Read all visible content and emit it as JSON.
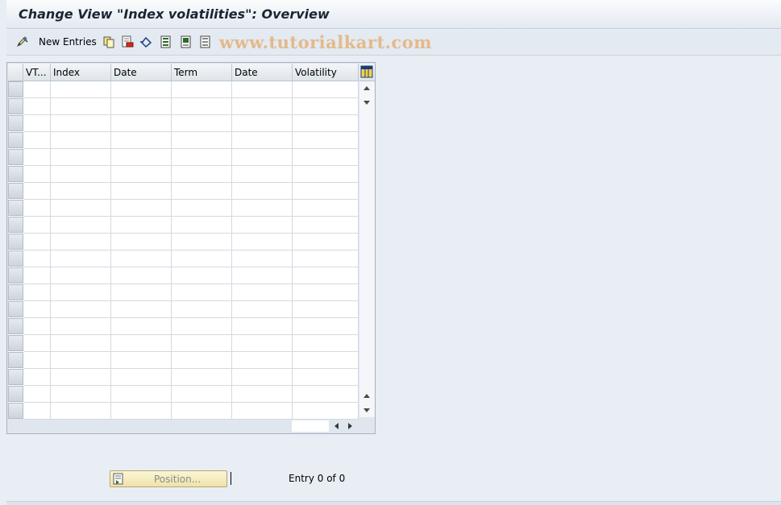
{
  "window": {
    "title": "Change View \"Index volatilities\": Overview"
  },
  "toolbar": {
    "new_entries_label": "New Entries",
    "icons": [
      "edit-pencil-icon",
      "copy-icon",
      "delete-icon",
      "undo-icon",
      "select-all-icon",
      "select-block-icon",
      "deselect-all-icon"
    ],
    "watermark": "www.tutorialkart.com"
  },
  "table": {
    "columns": [
      "VT...",
      "Index",
      "Date",
      "Term",
      "Date",
      "Volatility"
    ],
    "empty_rows": 20
  },
  "footer": {
    "position_button_label": "Position...",
    "entry_info": "Entry 0 of 0"
  },
  "colors": {
    "background": "#e9eef4",
    "title_text": "#1a2633",
    "position_button": "#f5ecc2"
  }
}
